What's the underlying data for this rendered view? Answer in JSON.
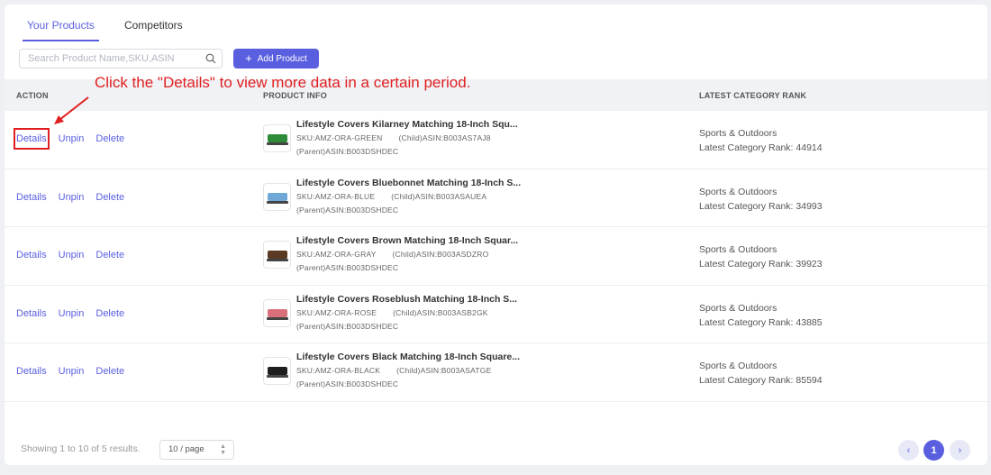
{
  "tabs": [
    {
      "label": "Your Products",
      "active": true
    },
    {
      "label": "Competitors",
      "active": false
    }
  ],
  "search": {
    "placeholder": "Search Product Name,SKU,ASIN",
    "value": ""
  },
  "add_button": {
    "label": "Add Product"
  },
  "table": {
    "headers": {
      "action": "ACTION",
      "product_info": "PRODUCT INFO",
      "rank": "LATEST CATEGORY RANK"
    },
    "action_labels": {
      "details": "Details",
      "unpin": "Unpin",
      "delete": "Delete"
    },
    "rows": [
      {
        "title": "Lifestyle Covers Kilarney Matching 18-Inch Squ...",
        "sku": "SKU:AMZ-ORA-GREEN",
        "child_asin": "(Child)ASIN:B003AS7AJ8",
        "parent_asin": "(Parent)ASIN:B003DSHDEC",
        "category": "Sports & Outdoors",
        "rank_text": "Latest Category Rank: 44914",
        "color": "#2e8b3a"
      },
      {
        "title": "Lifestyle Covers Bluebonnet Matching 18-Inch S...",
        "sku": "SKU:AMZ-ORA-BLUE",
        "child_asin": "(Child)ASIN:B003ASAUEA",
        "parent_asin": "(Parent)ASIN:B003DSHDEC",
        "category": "Sports & Outdoors",
        "rank_text": "Latest Category Rank: 34993",
        "color": "#6fa8d6"
      },
      {
        "title": "Lifestyle Covers Brown Matching 18-Inch Squar...",
        "sku": "SKU:AMZ-ORA-GRAY",
        "child_asin": "(Child)ASIN:B003ASDZRO",
        "parent_asin": "(Parent)ASIN:B003DSHDEC",
        "category": "Sports & Outdoors",
        "rank_text": "Latest Category Rank: 39923",
        "color": "#5a3a22"
      },
      {
        "title": "Lifestyle Covers Roseblush Matching 18-Inch S...",
        "sku": "SKU:AMZ-ORA-ROSE",
        "child_asin": "(Child)ASIN:B003ASB2GK",
        "parent_asin": "(Parent)ASIN:B003DSHDEC",
        "category": "Sports & Outdoors",
        "rank_text": "Latest Category Rank: 43885",
        "color": "#d9707a"
      },
      {
        "title": "Lifestyle Covers Black Matching 18-Inch Square...",
        "sku": "SKU:AMZ-ORA-BLACK",
        "child_asin": "(Child)ASIN:B003ASATGE",
        "parent_asin": "(Parent)ASIN:B003DSHDEC",
        "category": "Sports & Outdoors",
        "rank_text": "Latest Category Rank: 85594",
        "color": "#1e1e1e"
      }
    ]
  },
  "annotation": {
    "text": "Click the \"Details\" to view more data in a certain period."
  },
  "footer": {
    "results_text": "Showing 1 to 10 of 5 results.",
    "page_size": "10 / page",
    "current_page": "1"
  },
  "icons": {
    "search": "search-icon",
    "add": "plus-icon",
    "prev": "chevron-left-icon",
    "next": "chevron-right-icon",
    "caret": "updown-caret-icon"
  },
  "colors": {
    "accent": "#5a5fe0",
    "annotation": "#e02020"
  }
}
